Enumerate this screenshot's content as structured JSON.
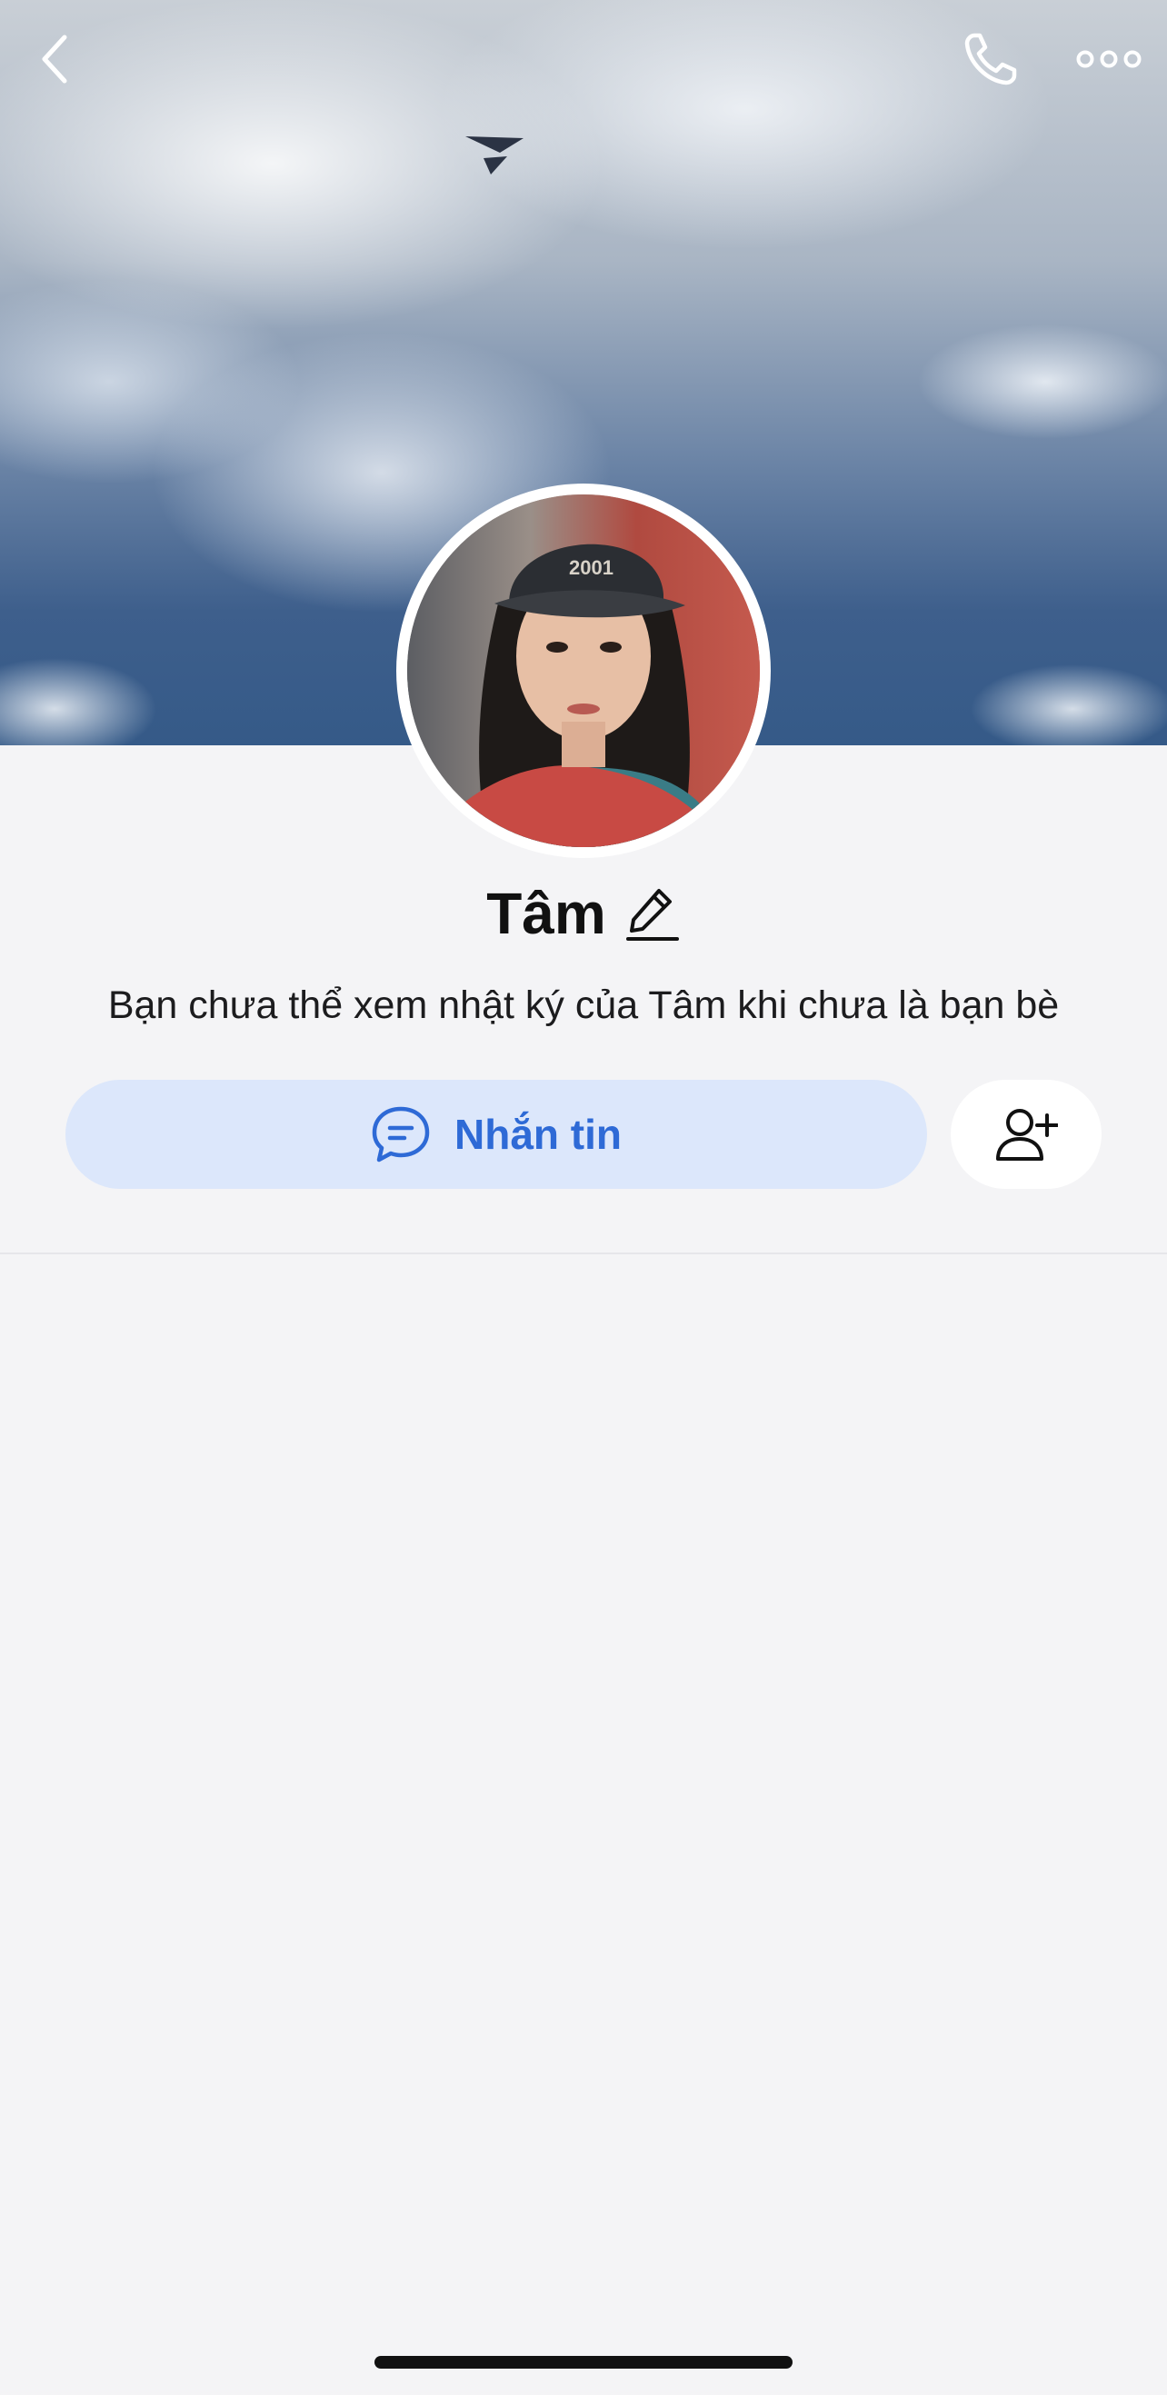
{
  "header": {
    "back_icon": "chevron-left-icon",
    "call_icon": "phone-icon",
    "more_icon": "more-dots-icon"
  },
  "profile": {
    "name": "Tâm",
    "edit_icon": "pencil-icon",
    "privacy_note": "Bạn chưa thể xem nhật ký của Tâm khi chưa là bạn bè",
    "avatar_cap_text": "2001"
  },
  "actions": {
    "message_label": "Nhắn tin",
    "message_icon": "chat-bubble-icon",
    "add_friend_icon": "add-user-icon"
  },
  "colors": {
    "accent": "#2e6ad6",
    "message_button_bg": "#dce7fb",
    "page_bg": "#f4f4f6"
  }
}
